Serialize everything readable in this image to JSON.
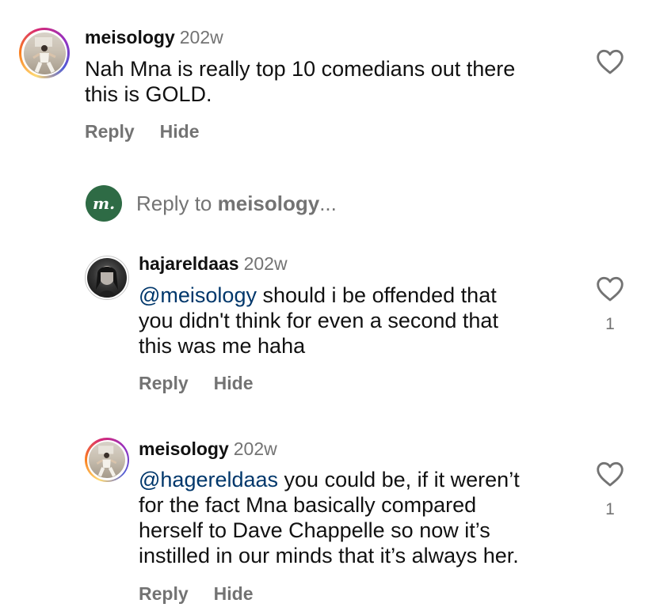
{
  "comments": [
    {
      "username": "meisology",
      "time": "202w",
      "text": "Nah Mna is really top 10 comedians out there\nthis is GOLD.",
      "reply_label": "Reply",
      "hide_label": "Hide",
      "avatar": "photo-room",
      "likes": ""
    },
    {
      "username": "hajareldaas",
      "time": "202w",
      "mention": "@meisology",
      "text": " should i be offended that\nyou didn't think for even a second that\nthis was me haha",
      "reply_label": "Reply",
      "hide_label": "Hide",
      "avatar": "photo-dark",
      "likes": "1"
    },
    {
      "username": "meisology",
      "time": "202w",
      "mention": "@hagereldaas",
      "text": " you could be, if it weren’t\nfor the fact Mna basically compared\nherself to Dave Chappelle so now it’s\ninstilled in our minds that it’s always her.",
      "reply_label": "Reply",
      "hide_label": "Hide",
      "avatar": "photo-room",
      "likes": "1"
    }
  ],
  "reply_box": {
    "logo_text": "m.",
    "prefix": "Reply to ",
    "target": "meisology",
    "suffix": "..."
  },
  "icons": {
    "like": "heart-outline-icon"
  },
  "colors": {
    "mention": "#00376b",
    "muted": "#737373",
    "logo_green": "#2e6b45"
  }
}
